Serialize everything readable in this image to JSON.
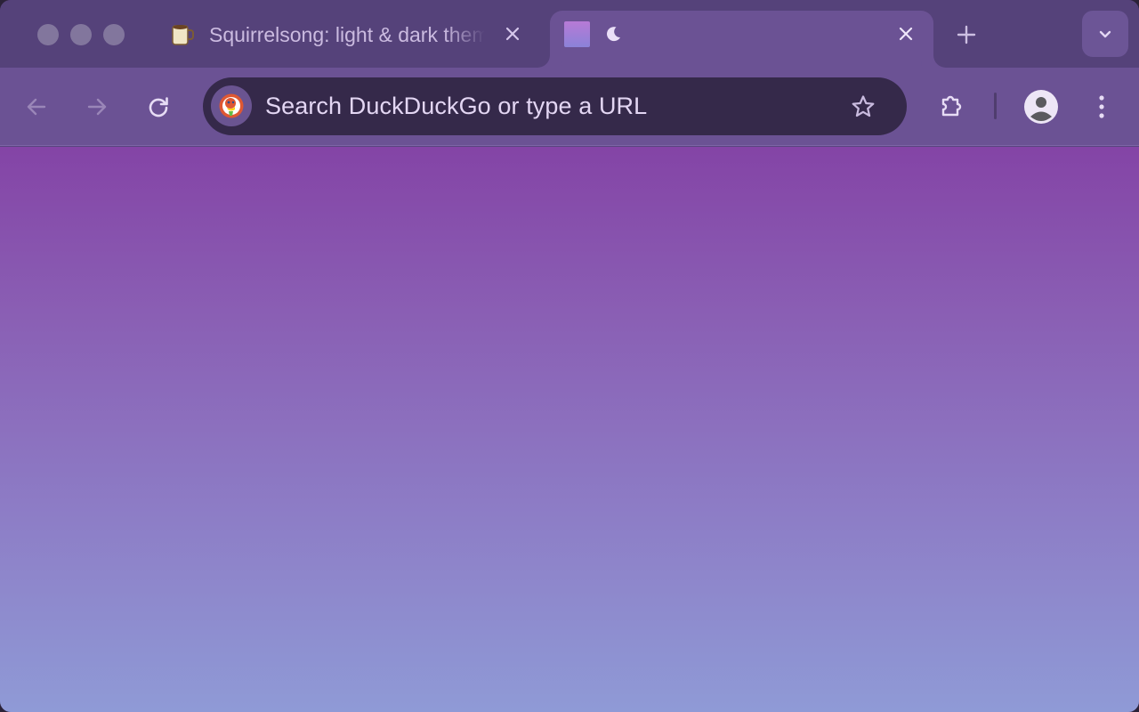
{
  "window": {
    "traffic_lights": [
      "close",
      "minimize",
      "zoom"
    ]
  },
  "tabs": [
    {
      "title": "Squirrelsong: light & dark themes",
      "favicon": "coffee-mug-icon",
      "active": false,
      "close_icon": "close-icon"
    },
    {
      "title": "",
      "favicon": "gradient-swatch-icon",
      "extra_icon": "moon-icon",
      "active": true,
      "close_icon": "close-icon"
    }
  ],
  "tabstrip": {
    "new_tab_icon": "plus-icon",
    "tab_search_icon": "chevron-down-icon"
  },
  "toolbar": {
    "back_icon": "arrow-left-icon",
    "forward_icon": "arrow-right-icon",
    "reload_icon": "reload-icon",
    "omnibox": {
      "search_engine_icon": "duckduckgo-icon",
      "placeholder": "Search DuckDuckGo or type a URL",
      "bookmark_icon": "star-icon"
    },
    "extensions_icon": "puzzle-icon",
    "profile_icon": "avatar-icon",
    "menu_icon": "kebab-menu-icon"
  },
  "colors": {
    "tabstrip_bg": "#55427a",
    "toolbar_bg": "#6b5294",
    "omnibox_bg": "#35294a",
    "content_gradient_top": "#8444a6",
    "content_gradient_bottom": "#8f9ad6"
  }
}
